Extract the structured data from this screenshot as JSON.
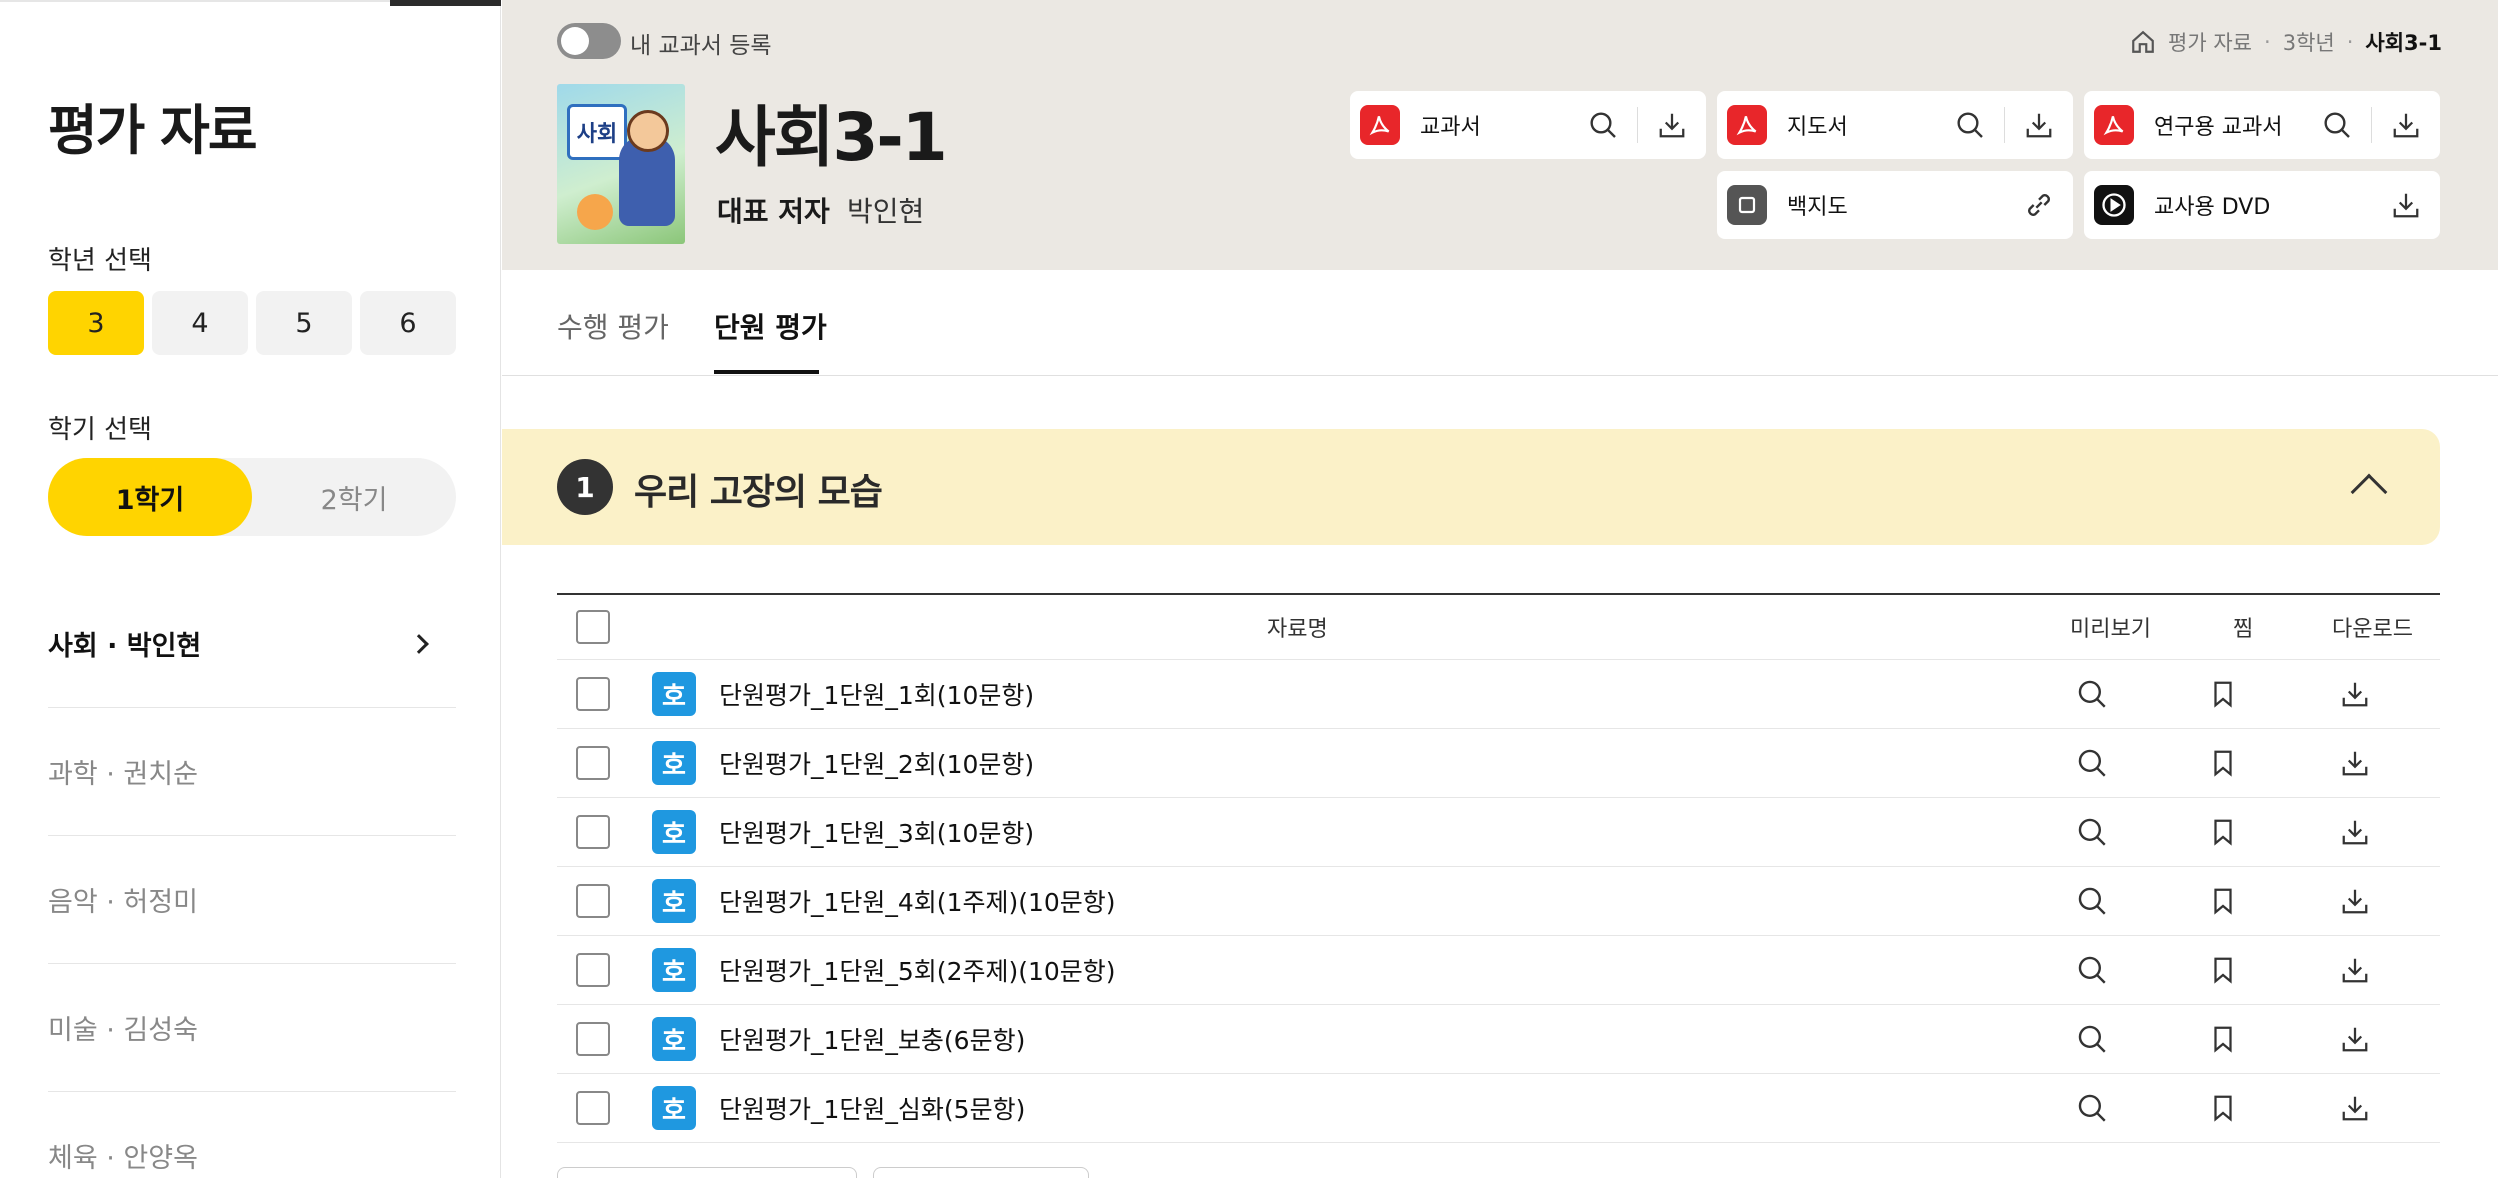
{
  "sidebar": {
    "title": "평가 자료",
    "grade_label": "학년 선택",
    "grades": [
      {
        "label": "3",
        "active": true
      },
      {
        "label": "4",
        "active": false
      },
      {
        "label": "5",
        "active": false
      },
      {
        "label": "6",
        "active": false
      }
    ],
    "semester_label": "학기 선택",
    "semesters": [
      {
        "label": "1학기",
        "active": true
      },
      {
        "label": "2학기",
        "active": false
      }
    ],
    "subjects": [
      {
        "label": "사회 · 박인현",
        "active": true
      },
      {
        "label": "과학 · 권치순",
        "active": false
      },
      {
        "label": "음악 · 허정미",
        "active": false
      },
      {
        "label": "미술 · 김성숙",
        "active": false
      },
      {
        "label": "체육 · 안양옥",
        "active": false
      }
    ]
  },
  "header": {
    "toggle_label": "내 교과서 등록",
    "breadcrumb": [
      "평가 자료",
      "3학년",
      "사회3-1"
    ],
    "book_title": "사회3-1",
    "cover_text": "사회",
    "author_label": "대표 저자",
    "author_name": "박인현",
    "resources": [
      {
        "name": "교과서",
        "icon": "pdf-icon",
        "actions": [
          "search-icon",
          "download-icon"
        ]
      },
      {
        "name": "지도서",
        "icon": "pdf-icon",
        "actions": [
          "search-icon",
          "download-icon"
        ]
      },
      {
        "name": "연구용 교과서",
        "icon": "pdf-icon",
        "actions": [
          "search-icon",
          "download-icon"
        ]
      },
      {
        "name": "백지도",
        "icon": "map-icon",
        "actions": [
          "link-icon"
        ]
      },
      {
        "name": "교사용 DVD",
        "icon": "play-icon",
        "actions": [
          "download-icon"
        ]
      }
    ]
  },
  "tabs": [
    {
      "label": "수행 평가",
      "active": false
    },
    {
      "label": "단원 평가",
      "active": true
    }
  ],
  "unit": {
    "number": "1",
    "title": "우리 고장의 모습"
  },
  "table": {
    "headers": {
      "name": "자료명",
      "preview": "미리보기",
      "favorite": "찜",
      "download": "다운로드"
    },
    "file_icon_text": "호",
    "rows": [
      {
        "name": "단원평가_1단원_1회(10문항)"
      },
      {
        "name": "단원평가_1단원_2회(10문항)"
      },
      {
        "name": "단원평가_1단원_3회(10문항)"
      },
      {
        "name": "단원평가_1단원_4회(1주제)(10문항)"
      },
      {
        "name": "단원평가_1단원_5회(2주제)(10문항)"
      },
      {
        "name": "단원평가_1단원_보충(6문항)"
      },
      {
        "name": "단원평가_1단원_심화(5문항)"
      }
    ]
  },
  "colors": {
    "accent": "#ffd400",
    "header_bg": "#ebe8e3",
    "unit_bg": "#fbf1c8",
    "pdf_red": "#e8262a",
    "hwp_blue": "#1f98e0"
  }
}
